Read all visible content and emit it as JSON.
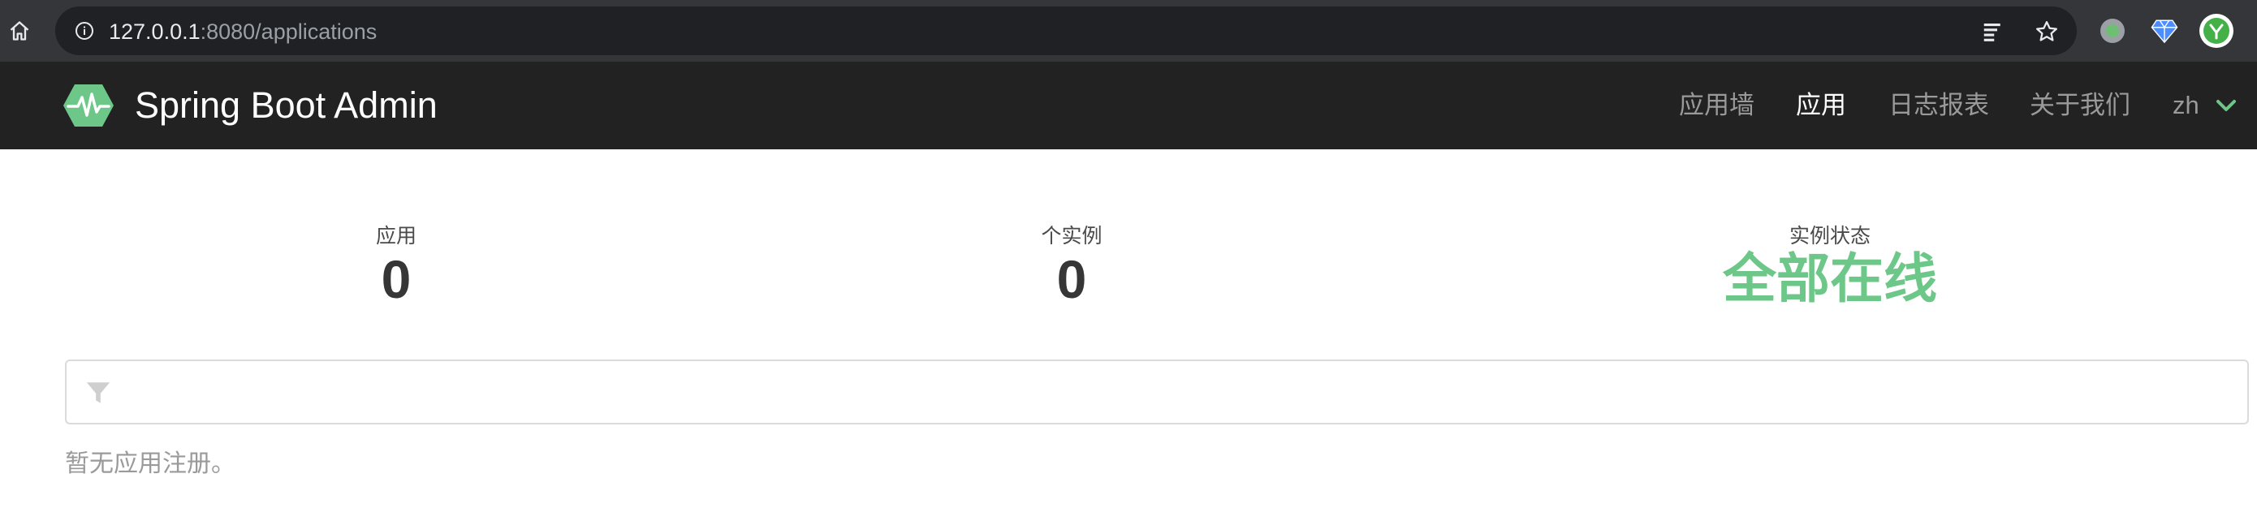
{
  "browser": {
    "url_host": "127.0.0.1",
    "url_rest": ":8080/applications"
  },
  "navbar": {
    "brand": "Spring Boot Admin",
    "items": [
      {
        "label": "应用墙"
      },
      {
        "label": "应用"
      },
      {
        "label": "日志报表"
      },
      {
        "label": "关于我们"
      }
    ],
    "active_item": "应用",
    "language": "zh"
  },
  "stats": {
    "applications": {
      "label": "应用",
      "value": "0"
    },
    "instances": {
      "label": "个实例",
      "value": "0"
    },
    "status": {
      "label": "实例状态",
      "value": "全部在线"
    }
  },
  "filter": {
    "value": "",
    "placeholder": ""
  },
  "empty_message": "暂无应用注册。",
  "colors": {
    "brand_green": "#6cc788",
    "navbar_bg": "#222222",
    "browser_bg": "#35363a"
  }
}
